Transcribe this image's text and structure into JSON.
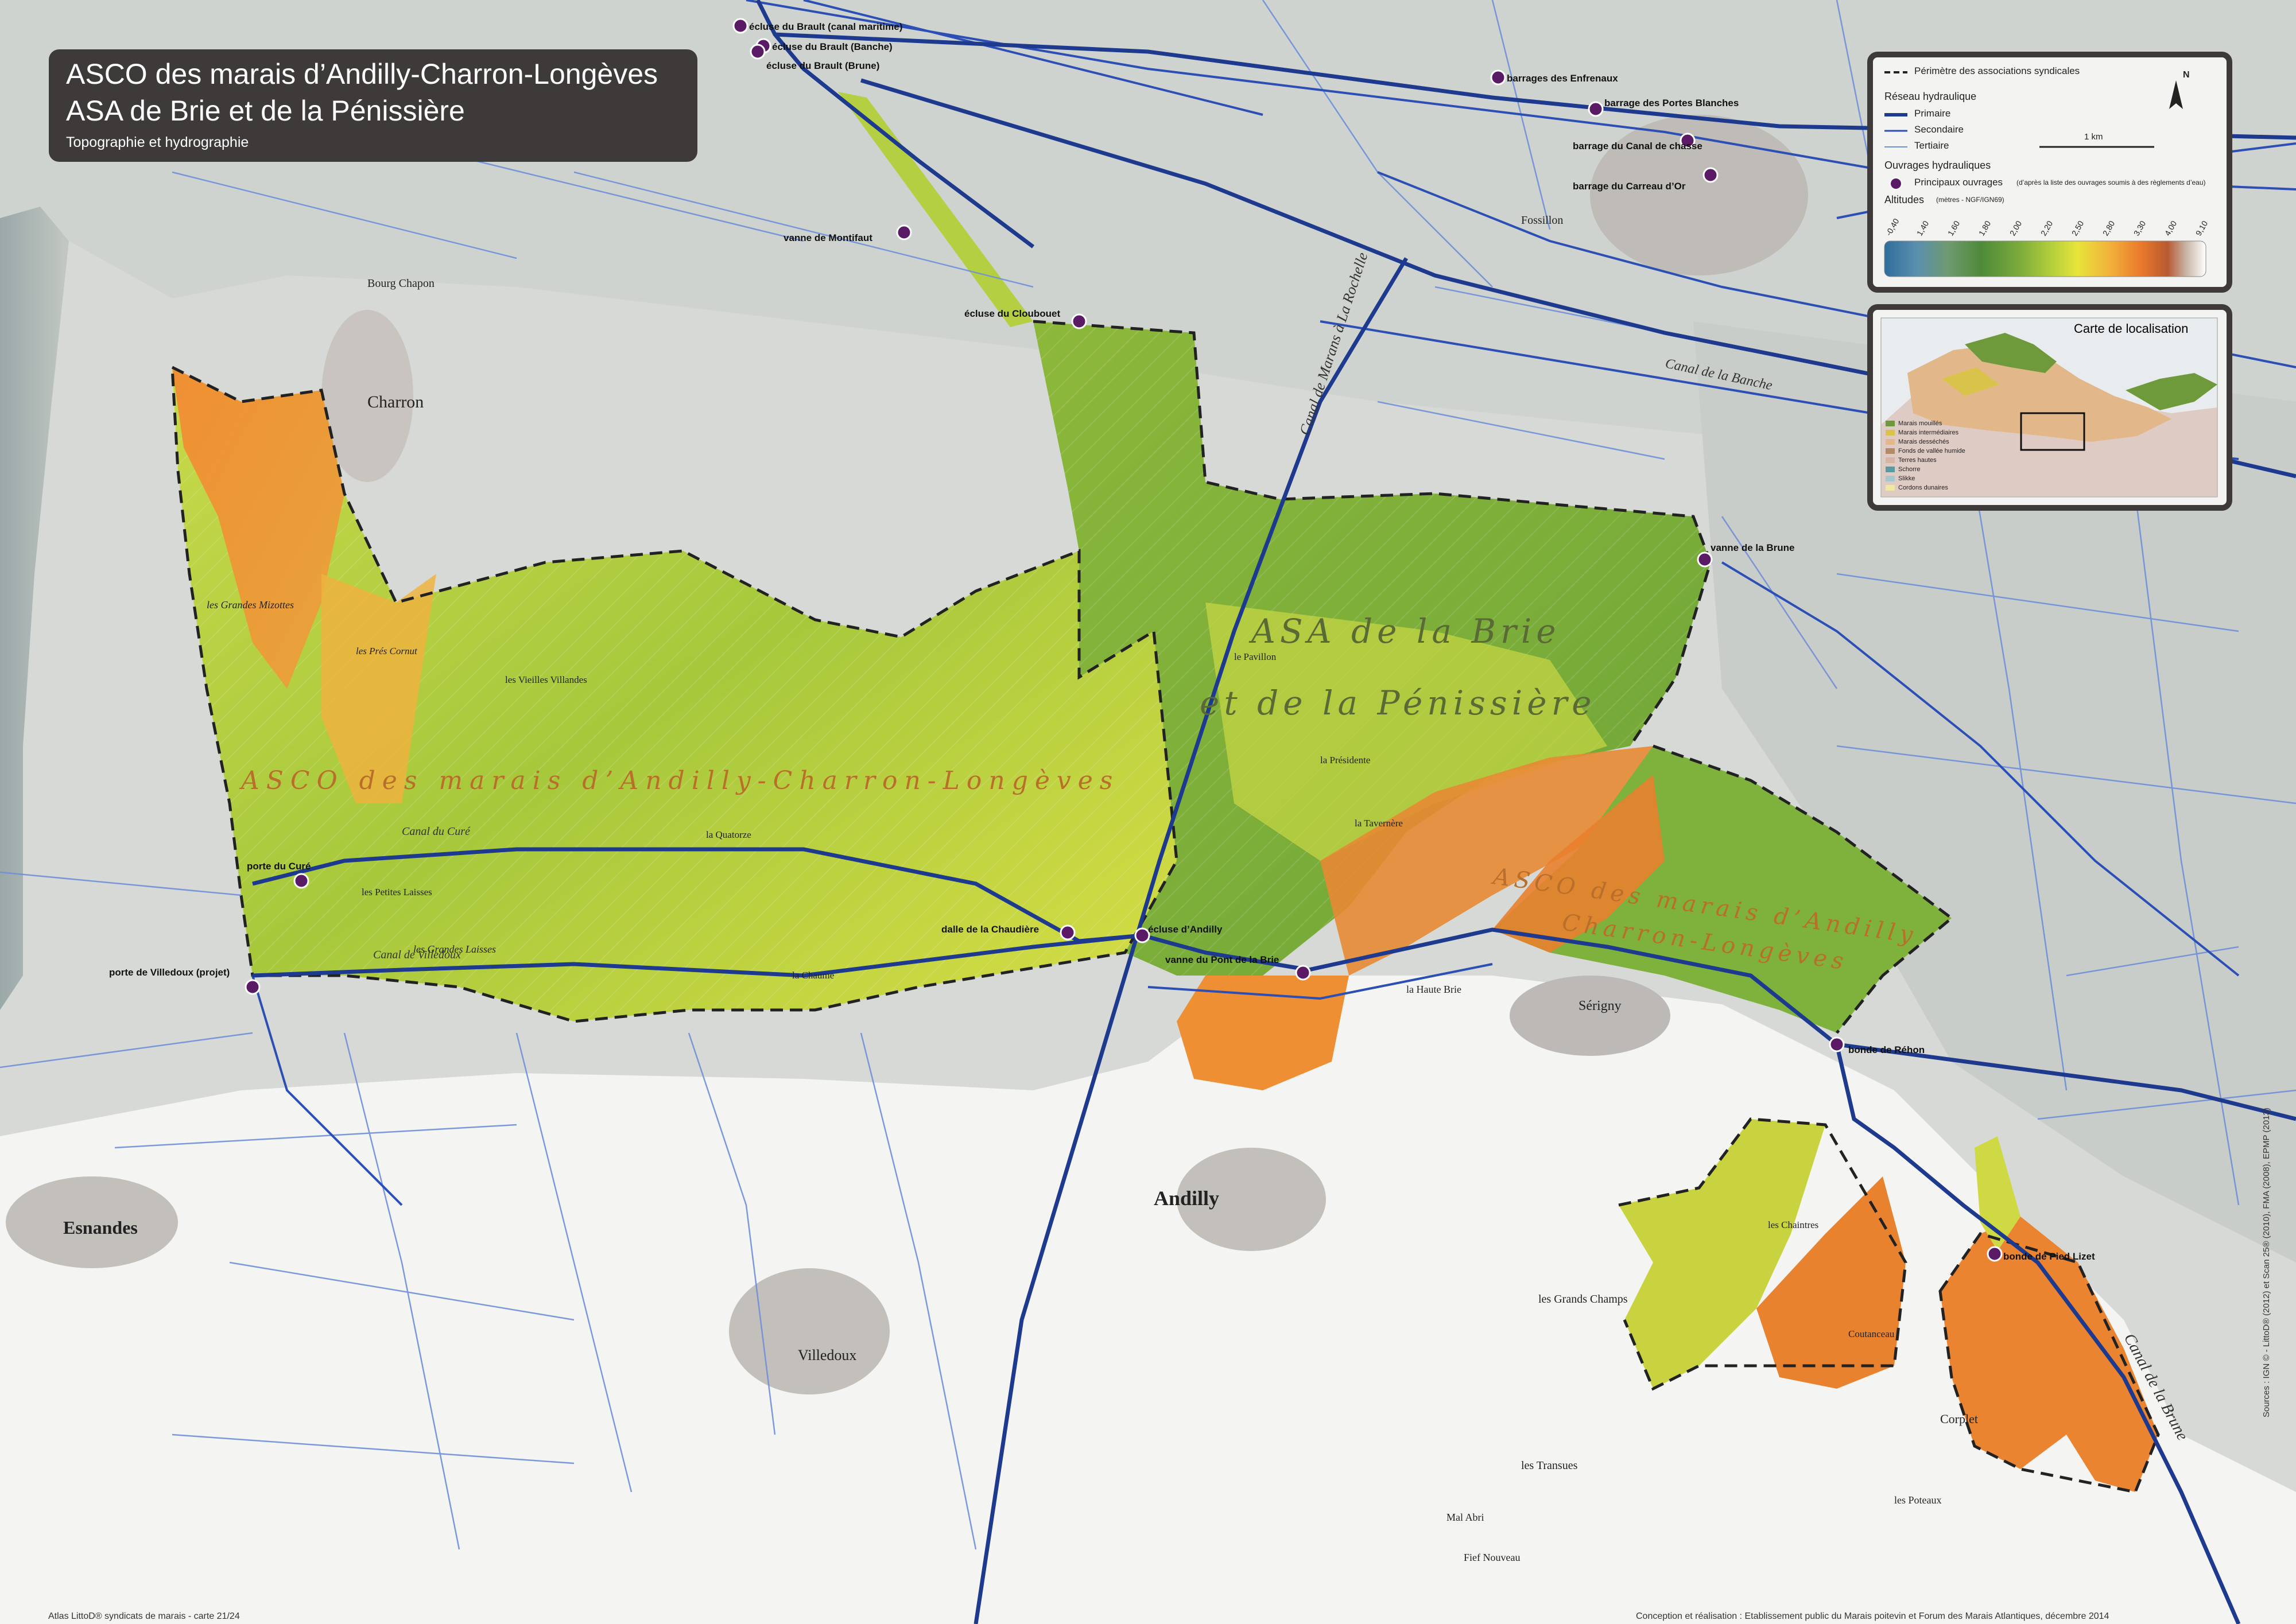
{
  "title": {
    "line1": "ASCO des marais d’Andilly-Charron-Longèves",
    "line2": "ASA de Brie et de la Pénissière",
    "line3": "Topographie et hydrographie"
  },
  "zones": {
    "asa_line1": "ASA de la Brie",
    "asa_line2": "et de la Pénissière",
    "asco_main": "ASCO des marais d’Andilly-Charron-Longèves",
    "asco_east_1": "ASCO des marais d’Andilly",
    "asco_east_2": "Charron-Longèves"
  },
  "ouvrages": [
    {
      "label": "écluse du Brault (canal maritime)"
    },
    {
      "label": "écluse du Brault (Banche)"
    },
    {
      "label": "écluse du Brault (Brune)"
    },
    {
      "label": "barrages des Enfrenaux"
    },
    {
      "label": "barrage des Portes Blanches"
    },
    {
      "label": "barrage du Canal de chasse"
    },
    {
      "label": "barrage du Carreau d’Or"
    },
    {
      "label": "vanne de Montifaut"
    },
    {
      "label": "écluse du Cloubouet"
    },
    {
      "label": "vanne de la Brune"
    },
    {
      "label": "porte du Curé"
    },
    {
      "label": "porte de Villedoux (projet)"
    },
    {
      "label": "dalle de la Chaudière"
    },
    {
      "label": "écluse d’Andilly"
    },
    {
      "label": "vanne du Pont de la Brie"
    },
    {
      "label": "bonde de Réhon"
    },
    {
      "label": "bonde de Pied Lizet"
    }
  ],
  "places": {
    "charron": "Charron",
    "andilly": "Andilly",
    "esnandes": "Esnandes",
    "villedoux": "Villedoux",
    "serigny": "Sérigny",
    "bourg_chapon": "Bourg Chapon",
    "fossillon": "Fossillon",
    "corplet": "Corplet",
    "les_grandes_mizottes": "les Grandes Mizottes",
    "les_grands_laisses": "les Grandes Laisses",
    "les_prees_cornut": "les Prés Cornut",
    "canal_du_cure": "Canal du Curé",
    "canal_de_la_banche": "Canal de la Banche",
    "canal_de_villedoux": "Canal de Villedoux",
    "le_pavillon": "le Pavillon",
    "la_presidente": "la Présidente",
    "les_chaintres": "les Chaintres",
    "la_coutanceau": "Coutanceau",
    "la_tavernere": "la Tavernère",
    "les_vieilles_villandes": "les Vieilles Villandes",
    "la_quatorze": "la Quatorze",
    "la_chaume": "la Chaume",
    "les_petites_laisses": "les Petites Laisses",
    "la_haute_brie": "la Haute Brie",
    "canal_de_la_brune": "Canal de la Brune",
    "canal_de_marans": "Canal de Marans à La Rochelle",
    "les_grands_champs": "les Grands Champs",
    "les_transues": "les Transues",
    "mal_abri": "Mal Abri",
    "fief_nouveau": "Fief Nouveau",
    "les_poteaux": "les Poteaux"
  },
  "legend": {
    "perimetre": "Périmètre des associations syndicales",
    "reseau": "Réseau hydraulique",
    "primaire": "Primaire",
    "secondaire": "Secondaire",
    "tertiaire": "Tertiaire",
    "ouvrages": "Ouvrages hydrauliques",
    "principaux": "Principaux ouvrages",
    "principaux_note": "(d’après la liste des ouvrages soumis à des règlements d’eau)",
    "altitudes": "Altitudes",
    "altitudes_unit": "(mètres - NGF/IGN69)",
    "scale": "1 km",
    "north": "N",
    "ticks": [
      "-0,40",
      "1,40",
      "1,60",
      "1,80",
      "2,00",
      "2,20",
      "2,50",
      "2,80",
      "3,30",
      "4,00",
      "9,10"
    ],
    "ramp": [
      "#2f6d9c",
      "#5a8fae",
      "#6f9a6f",
      "#4e8a3a",
      "#7cab3b",
      "#b3cf3c",
      "#e8e43a",
      "#f3b23c",
      "#e9782c",
      "#b85a30",
      "#c9b6a8",
      "#ffffff"
    ]
  },
  "location": {
    "title": "Carte de localisation",
    "classes": [
      {
        "label": "Marais mouillés",
        "color": "#6e9a3c"
      },
      {
        "label": "Marais intermédiaires",
        "color": "#d9c34a"
      },
      {
        "label": "Marais desséchés",
        "color": "#e2b88a"
      },
      {
        "label": "Fonds de vallée humide",
        "color": "#b58a6a"
      },
      {
        "label": "Terres hautes",
        "color": "#d7b5a6"
      },
      {
        "label": "Schorre",
        "color": "#5a9aa0"
      },
      {
        "label": "Slikke",
        "color": "#a6c7cf"
      },
      {
        "label": "Cordons dunaires",
        "color": "#f1e7a0"
      }
    ]
  },
  "credits": {
    "left": "Atlas LittoD® syndicats de marais - carte 21/24",
    "right": "Conception et réalisation : Etablissement public du Marais poitevin et Forum des Marais Atlantiques, décembre 2014",
    "vertical": "Sources : IGN © - LittoD® (2012) et Scan 25® (2010), FMA (2008), EPMP (2013)"
  },
  "colors": {
    "primary": "#1e3a8f",
    "secondary": "#2c4fb5",
    "tertiary": "#6f8fd8",
    "ouvrage": "#5b1a66",
    "panel": "#3e3a3a"
  }
}
